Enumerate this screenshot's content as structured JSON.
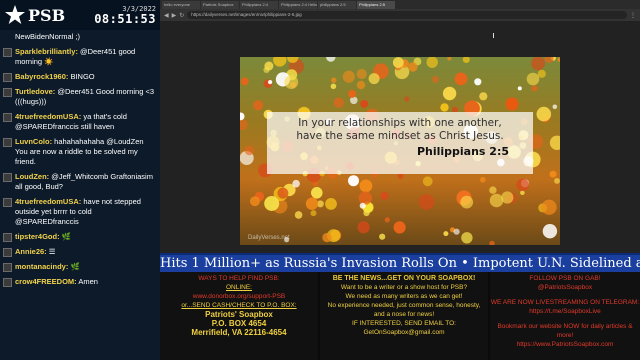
{
  "chat": {
    "logo_text": "PSB",
    "date": "3/3/2022",
    "time": "08:51:53",
    "messages": [
      {
        "user": "",
        "text": "NewBidenNormal ;)"
      },
      {
        "user": "Sparklebrilliantly:",
        "text": "@Deer451 good morning ☀️"
      },
      {
        "user": "Babyrock1960:",
        "text": "BINGO"
      },
      {
        "user": "Turtledove:",
        "text": "@Deer451 Good morning <3 (((hugs)))"
      },
      {
        "user": "4truefreedomUSA:",
        "text": "ya that's cold @SPAREDfranccis still haven"
      },
      {
        "user": "LuvnColo:",
        "text": "hahahahahaha @LoudZen You are now a riddle to be solved my friend."
      },
      {
        "user": "LoudZen:",
        "text": "@Jeff_Whitcomb Graftoniasim all good, Bud?"
      },
      {
        "user": "4truefreedomUSA:",
        "text": "have not stepped outside yet brrrr to cold @SPAREDfranccis"
      },
      {
        "user": "tipster4God:",
        "text": "🌿"
      },
      {
        "user": "Annie26:",
        "text": "☰"
      },
      {
        "user": "montanacindy:",
        "text": "🌿"
      },
      {
        "user": "crow4FREEDOM:",
        "text": "Amen"
      }
    ]
  },
  "browser": {
    "tabs": [
      "hello everyone",
      "Patriots Soapbox",
      "Philippians 2:4",
      "Philippians 2:4 Hello",
      "philippians 2:5",
      "Philippians 2:5"
    ],
    "url": "https://dailyverses.net/images/en/niv/philippians-2-5.jpg"
  },
  "verse": {
    "text_line1": "In your relationships with one another,",
    "text_line2": "have the same mindset as Christ Jesus.",
    "reference": "Philippians 2:5",
    "watermark": "DailyVerses.net"
  },
  "ticker": {
    "text": "Hits 1 Million+ as Russia's Invasion Rolls On  •  Impotent U.N. Sidelined as Ch"
  },
  "panels": {
    "help": {
      "title": "WAYS TO HELP FIND PSB:",
      "online": "ONLINE:",
      "donor_link": "www.donorbox.org/support-PSB",
      "or_send": "or...SEND CASH/CHECK TO P.O. BOX:",
      "addr1": "Patriots' Soapbox",
      "addr2": "P.O. BOX 4654",
      "addr3": "Merrifield, VA 22116-4654"
    },
    "news": {
      "title": "BE THE NEWS...GET ON YOUR SOAPBOX!",
      "l1": "Want to be a writer or a show host for PSB?",
      "l2": "We need as many writers as we can get!",
      "l3": "No experience needed, just common sense, honesty,",
      "l4": "and a nose for news!",
      "l5": "IF INTERESTED, SEND EMAIL TO:",
      "email": "GetOnSoapbox@gmail.com"
    },
    "follow": {
      "title": "FOLLOW PSB ON GAB!",
      "gab": "@PatriotsSoapbox",
      "telegram_title": "WE ARE NOW LIVESTREAMING ON TELEGRAM:",
      "telegram_link": "https://t.me/SoapboxLive",
      "bookmark": "Bookmark our website NOW for daily articles & more!",
      "site": "https://www.PatriotsSoapbox.com"
    }
  },
  "colors": {
    "ticker_bg": "#1a3f9e",
    "chat_bg": "#0c1a2a",
    "username": "#f2d24a",
    "panel_heading_red": "#e23a2a"
  }
}
